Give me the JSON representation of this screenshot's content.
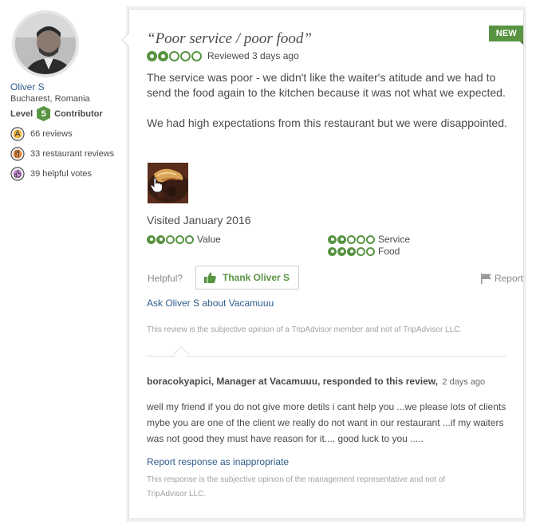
{
  "member": {
    "name": "Oliver S",
    "location": "Bucharest, Romania",
    "level_prefix": "Level",
    "level": "5",
    "level_suffix": "Contributor",
    "stats": [
      {
        "icon": "review-badge-icon",
        "text": "66 reviews"
      },
      {
        "icon": "restaurant-icon",
        "text": "33 restaurant reviews"
      },
      {
        "icon": "thumbs-up-icon",
        "text": "39 helpful votes"
      }
    ]
  },
  "review": {
    "badge": "NEW",
    "title": "“Poor service / poor food”",
    "rating": 2,
    "rating_max": 5,
    "reviewed": "Reviewed 3 days ago",
    "paragraphs": [
      "The service was poor - we didn't like the waiter's atitude and we had to send the food again to the kitchen because it was not what we expected.",
      "We had high expectations from this restaurant but we were disappointed."
    ],
    "visited": "Visited January 2016",
    "sub_ratings": [
      {
        "label": "Value",
        "rating": 2
      },
      {
        "label": "Service",
        "rating": 2
      },
      {
        "label": "Food",
        "rating": 3
      }
    ],
    "helpful_label": "Helpful?",
    "thank_label": "Thank Oliver S",
    "report_label": "Report",
    "ask_link": "Ask Oliver S about Vacamuuu",
    "disclaimer": "This review is the subjective opinion of a TripAdvisor member and not of TripAdvisor LLC."
  },
  "response": {
    "author": "boracokyapici, Manager at Vacamuuu, responded to this review,",
    "date": "2 days ago",
    "text": "well my friend if you do not give more detils i cant help you ...we please lots of clients mybe you are one of the client we really do not want in our restaurant ...if my waiters was not good they must have reason for it.... good luck to you .....",
    "report_link": "Report response as inappropriate",
    "disclaimer": "This response is the subjective opinion of the management representative and not of TripAdvisor LLC."
  },
  "colors": {
    "accent_green": "#589442",
    "link_blue": "#2f5c8a",
    "muted_gray": "#a2a2a2"
  }
}
